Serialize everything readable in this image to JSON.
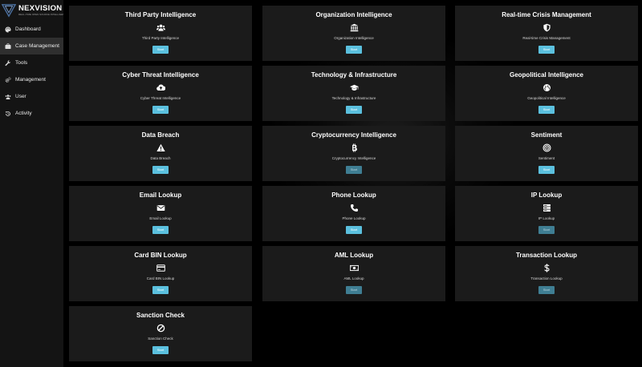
{
  "brand": {
    "name": "NEXVISION",
    "tagline": "REAL-TIME OPEN SOURCE INTELLIGENCE"
  },
  "sidebar": {
    "items": [
      {
        "label": "Dashboard",
        "icon": "palette-icon",
        "active": false
      },
      {
        "label": "Case Management",
        "icon": "briefcase-icon",
        "active": true
      },
      {
        "label": "Tools",
        "icon": "wrench-icon",
        "active": false
      },
      {
        "label": "Management",
        "icon": "gears-icon",
        "active": false
      },
      {
        "label": "User",
        "icon": "users-icon",
        "active": false
      },
      {
        "label": "Activity",
        "icon": "history-icon",
        "active": false
      }
    ]
  },
  "colors": {
    "accent": "#5bc0de",
    "accent_disabled": "#3f7e93",
    "card_bg": "#1b1b1b",
    "sidebar_bg": "#141414"
  },
  "cards": [
    {
      "title": "Third Party Intelligence",
      "subtitle": "Third Party Intelligence",
      "icon": "users-icon",
      "button": "Start",
      "enabled": true
    },
    {
      "title": "Organization Intelligence",
      "subtitle": "Organization Intelligence",
      "icon": "bank-icon",
      "button": "Start",
      "enabled": true
    },
    {
      "title": "Real-time Crisis Management",
      "subtitle": "Real-time Crisis Management",
      "icon": "shield-icon",
      "button": "Start",
      "enabled": true
    },
    {
      "title": "Cyber Threat Intelligence",
      "subtitle": "Cyber Threat Intelligence",
      "icon": "cloud-upload-icon",
      "button": "Start",
      "enabled": true
    },
    {
      "title": "Technology & Infrastructure",
      "subtitle": "Technology & Infrastructure",
      "icon": "graduation-cap-icon",
      "button": "Start",
      "enabled": true
    },
    {
      "title": "Geopolitical Intelligence",
      "subtitle": "Geopolitical Intelligence",
      "icon": "globe-icon",
      "button": "Start",
      "enabled": true
    },
    {
      "title": "Data Breach",
      "subtitle": "Data Breach",
      "icon": "warning-icon",
      "button": "Start",
      "enabled": true
    },
    {
      "title": "Cryptocurrency Intelligence",
      "subtitle": "Cryptocurrency Intelligence",
      "icon": "bitcoin-icon",
      "button": "Start",
      "enabled": false
    },
    {
      "title": "Sentiment",
      "subtitle": "Sentiment",
      "icon": "target-icon",
      "button": "Start",
      "enabled": true
    },
    {
      "title": "Email Lookup",
      "subtitle": "Email Lookup",
      "icon": "envelope-icon",
      "button": "Start",
      "enabled": true
    },
    {
      "title": "Phone Lookup",
      "subtitle": "Phone Lookup",
      "icon": "phone-icon",
      "button": "Start",
      "enabled": true
    },
    {
      "title": "IP Lookup",
      "subtitle": "IP Lookup",
      "icon": "server-icon",
      "button": "Start",
      "enabled": false
    },
    {
      "title": "Card BIN Lookup",
      "subtitle": "Card BIN Lookup",
      "icon": "credit-card-icon",
      "button": "Start",
      "enabled": true
    },
    {
      "title": "AML Lookup",
      "subtitle": "AML Lookup",
      "icon": "money-bill-icon",
      "button": "Start",
      "enabled": false
    },
    {
      "title": "Transaction Lookup",
      "subtitle": "Transaction Lookup",
      "icon": "dollar-icon",
      "button": "Start",
      "enabled": false
    },
    {
      "title": "Sanction Check",
      "subtitle": "Sanction Check",
      "icon": "ban-icon",
      "button": "Start",
      "enabled": true
    }
  ]
}
